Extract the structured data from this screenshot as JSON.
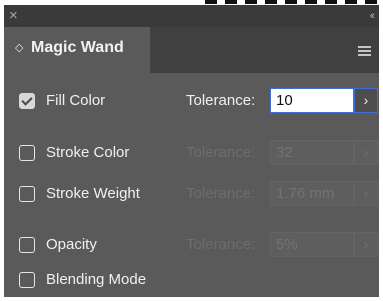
{
  "panel": {
    "close_glyph": "×",
    "collapse_glyph": "‹‹",
    "tab_arrows_glyph": "◇",
    "title": "Magic Wand"
  },
  "rows": [
    {
      "label": "Fill Color",
      "checked": true,
      "tolerance_label": "Tolerance:",
      "value": "10",
      "enabled": true,
      "stepper": "›"
    },
    {
      "label": "Stroke Color",
      "checked": false,
      "tolerance_label": "Tolerance:",
      "value": "32",
      "enabled": false,
      "stepper": "›"
    },
    {
      "label": "Stroke Weight",
      "checked": false,
      "tolerance_label": "Tolerance:",
      "value": "1.76 mm",
      "enabled": false,
      "stepper": "›"
    },
    {
      "label": "Opacity",
      "checked": false,
      "tolerance_label": "Tolerance:",
      "value": "5%",
      "enabled": false,
      "stepper": "›"
    },
    {
      "label": "Blending Mode",
      "checked": false
    }
  ],
  "icons": {
    "close": "close-icon",
    "collapse": "collapse-icon",
    "tab_arrows": "sort-arrows-icon",
    "menu": "hamburger-menu-icon",
    "check": "checkmark-icon",
    "stepper": "chevron-right-icon"
  },
  "colors": {
    "panel_bg": "#5a5a5a",
    "titlebar_bg": "#3a3a3a",
    "focus_accent": "#3e6fd6",
    "text": "#f0f0f0",
    "disabled_text": "#6d6d6d"
  }
}
